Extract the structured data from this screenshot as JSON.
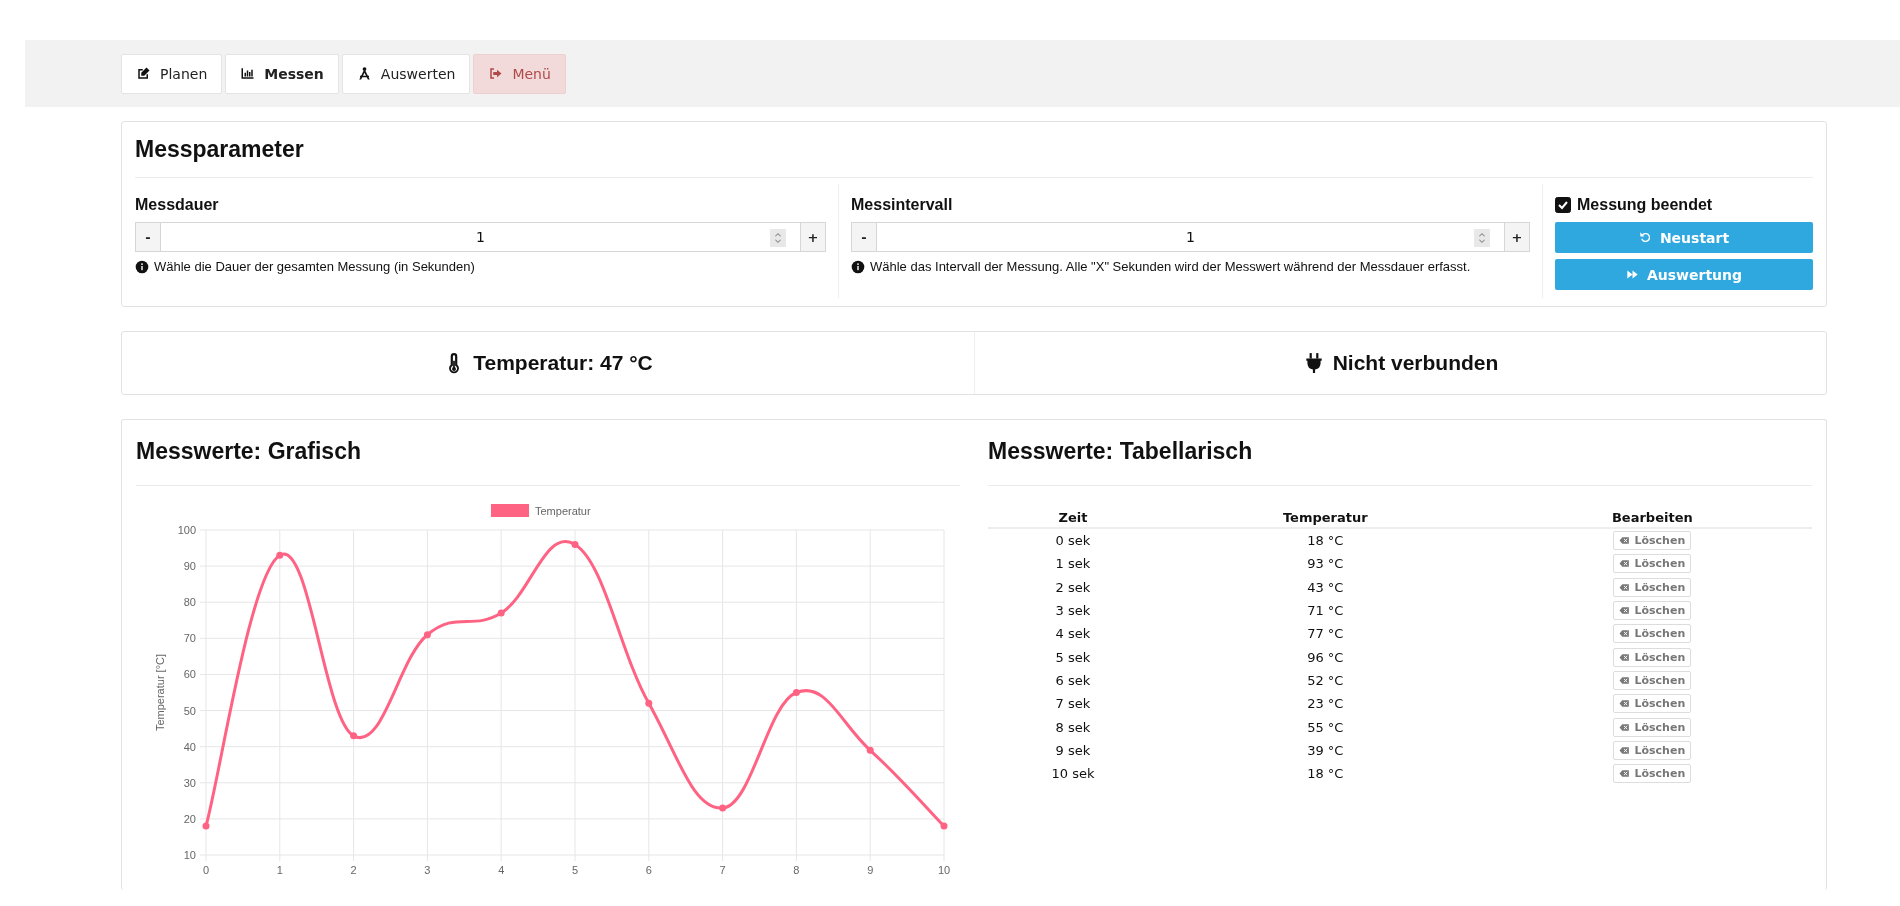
{
  "tabs": [
    {
      "label": "Planen",
      "selected": false,
      "kind": "normal"
    },
    {
      "label": "Messen",
      "selected": true,
      "kind": "normal"
    },
    {
      "label": "Auswerten",
      "selected": false,
      "kind": "normal"
    },
    {
      "label": "Menü",
      "selected": false,
      "kind": "danger"
    }
  ],
  "parameters": {
    "title": "Messparameter",
    "fields": [
      {
        "label": "Messdauer",
        "value": "1",
        "minus": "-",
        "plus": "+",
        "hint": "Wähle die Dauer der gesamten Messung (in Sekunden)"
      },
      {
        "label": "Messintervall",
        "value": "1",
        "minus": "-",
        "plus": "+",
        "hint": "Wähle das Intervall der Messung. Alle \"X\" Sekunden wird der Messwert während der Messdauer erfasst."
      }
    ],
    "status": {
      "label": "Messung beendet",
      "checked": true
    },
    "buttons": [
      {
        "label": "Neustart"
      },
      {
        "label": "Auswertung"
      }
    ]
  },
  "readings": [
    {
      "text": "Temperatur: 47 °C"
    },
    {
      "text": "Nicht verbunden"
    }
  ],
  "graph": {
    "title": "Messwerte: Grafisch",
    "chart_data": {
      "type": "line",
      "ylabel": "Temperatur [°C]",
      "x": [
        0,
        1,
        2,
        3,
        4,
        5,
        6,
        7,
        8,
        9,
        10
      ],
      "series": [
        {
          "name": "Temperatur",
          "color": "#ff6384",
          "values": [
            18,
            93,
            43,
            71,
            77,
            96,
            52,
            23,
            55,
            39,
            18
          ]
        }
      ],
      "xlim": [
        0,
        10
      ],
      "ylim": [
        10,
        100
      ],
      "grid": true,
      "marker": true,
      "yticks": [
        10,
        20,
        30,
        40,
        50,
        60,
        70,
        80,
        90,
        100
      ],
      "xticks": [
        0,
        1,
        2,
        3,
        4,
        5,
        6,
        7,
        8,
        9,
        10
      ]
    }
  },
  "table": {
    "title": "Messwerte: Tabellarisch",
    "columns": [
      "Zeit",
      "Temperatur",
      "Bearbeiten"
    ],
    "rows": [
      {
        "time": "0 sek",
        "temperature": "18 °C",
        "action": "Löschen"
      },
      {
        "time": "1 sek",
        "temperature": "93 °C",
        "action": "Löschen"
      },
      {
        "time": "2 sek",
        "temperature": "43 °C",
        "action": "Löschen"
      },
      {
        "time": "3 sek",
        "temperature": "71 °C",
        "action": "Löschen"
      },
      {
        "time": "4 sek",
        "temperature": "77 °C",
        "action": "Löschen"
      },
      {
        "time": "5 sek",
        "temperature": "96 °C",
        "action": "Löschen"
      },
      {
        "time": "6 sek",
        "temperature": "52 °C",
        "action": "Löschen"
      },
      {
        "time": "7 sek",
        "temperature": "23 °C",
        "action": "Löschen"
      },
      {
        "time": "8 sek",
        "temperature": "55 °C",
        "action": "Löschen"
      },
      {
        "time": "9 sek",
        "temperature": "39 °C",
        "action": "Löschen"
      },
      {
        "time": "10 sek",
        "temperature": "18 °C",
        "action": "Löschen"
      }
    ]
  }
}
